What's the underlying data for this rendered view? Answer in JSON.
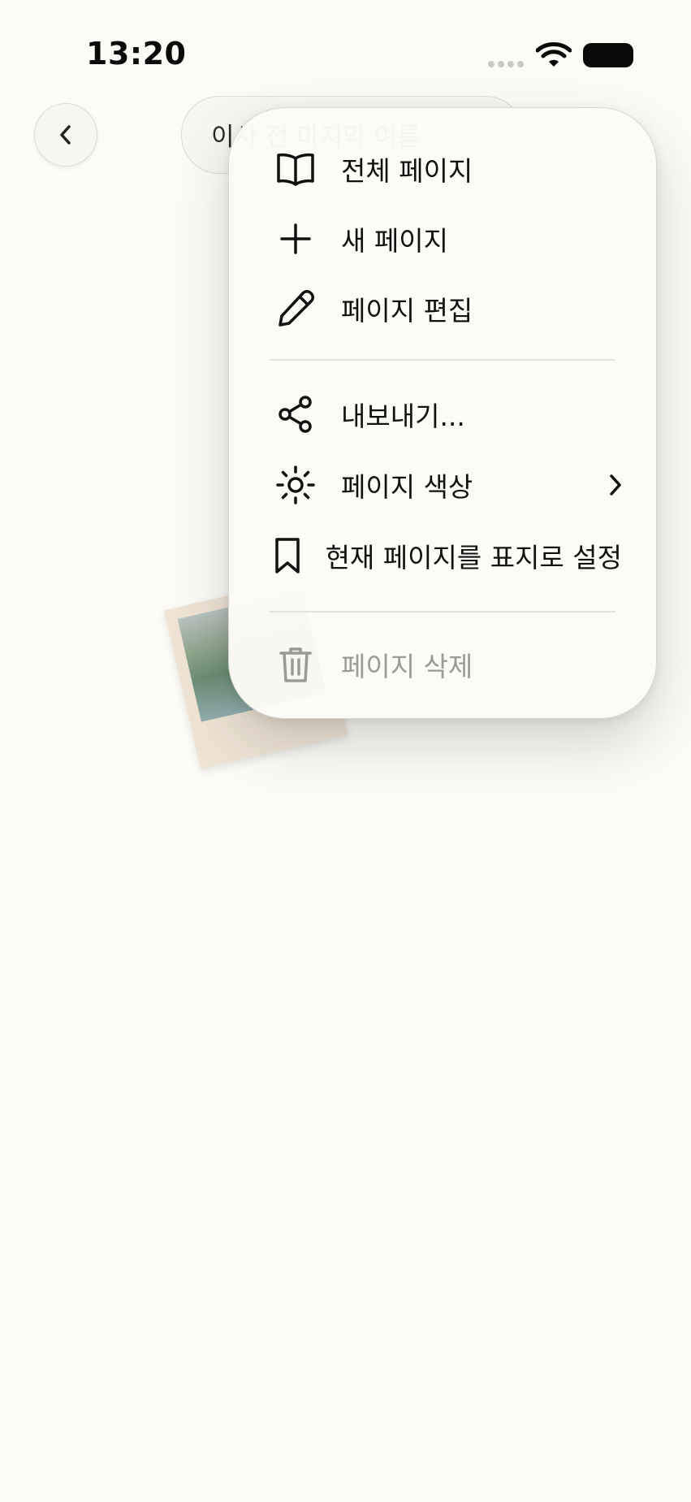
{
  "status_bar": {
    "time": "13:20"
  },
  "nav": {
    "title": "이사 전 마지막 여름"
  },
  "menu": {
    "items": [
      {
        "label": "전체 페이지",
        "icon": "book-open-icon"
      },
      {
        "label": "새 페이지",
        "icon": "plus-icon"
      },
      {
        "label": "페이지 편집",
        "icon": "pencil-icon"
      },
      {
        "label": "내보내기...",
        "icon": "share-icon"
      },
      {
        "label": "페이지 색상",
        "icon": "sun-icon",
        "has_submenu": true
      },
      {
        "label": "현재 페이지를 표지로 설정",
        "icon": "bookmark-icon"
      },
      {
        "label": "페이지 삭제",
        "icon": "trash-icon",
        "disabled": true
      }
    ]
  },
  "colors": {
    "background": "#fcfbf6",
    "menu_background": "#fcfbf6",
    "disabled_text": "#9a9a96"
  }
}
